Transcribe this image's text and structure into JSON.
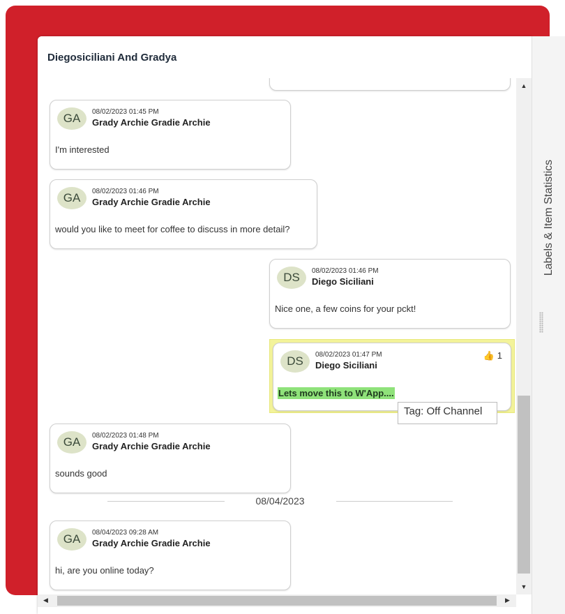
{
  "conversation": {
    "title": "Diegosiciliani And Gradya"
  },
  "messages": [
    {
      "initials": "GA",
      "timestamp": "08/02/2023 01:45 PM",
      "sender": "Grady Archie Gradie Archie",
      "text": "I'm interested"
    },
    {
      "initials": "GA",
      "timestamp": "08/02/2023 01:46 PM",
      "sender": "Grady Archie Gradie Archie",
      "text": "would you like to meet for coffee to discuss in more detail?"
    },
    {
      "initials": "DS",
      "timestamp": "08/02/2023 01:46 PM",
      "sender": "Diego Siciliani",
      "text": "Nice one, a few coins for your pckt!"
    },
    {
      "initials": "DS",
      "timestamp": "08/02/2023 01:47 PM",
      "sender": "Diego Siciliani",
      "text": "Lets move this to W'App....",
      "reaction_icon": "thumbs-up-icon",
      "reaction_count": "1",
      "tag_tooltip": "Tag: Off Channel"
    },
    {
      "initials": "GA",
      "timestamp": "08/02/2023 01:48 PM",
      "sender": "Grady Archie Gradie Archie",
      "text": "sounds good"
    },
    {
      "initials": "GA",
      "timestamp": "08/04/2023 09:28 AM",
      "sender": "Grady Archie Gradie Archie",
      "text": "hi, are you online today?"
    }
  ],
  "date_separator": "08/04/2023",
  "side_panel": {
    "label": "Labels & Item Statistics"
  },
  "colors": {
    "background_accent": "#d0202a",
    "flag_highlight": "#f3f39a",
    "text_highlight": "#8fe27a",
    "avatar": "#dde3c8"
  }
}
